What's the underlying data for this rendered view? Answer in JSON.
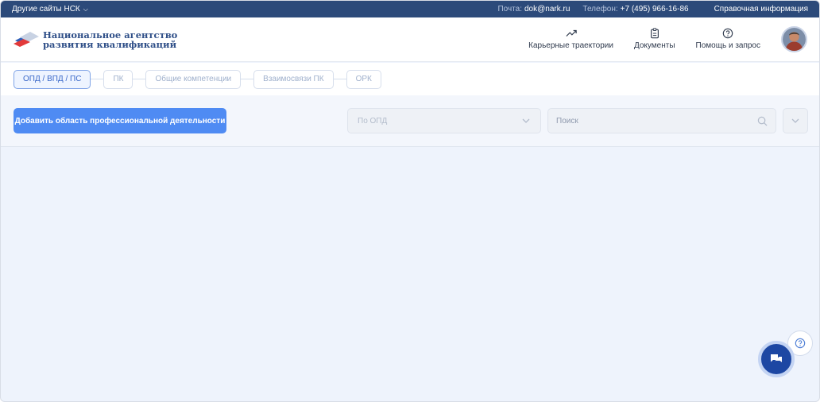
{
  "topbar": {
    "other_sites": "Другие сайты НСК",
    "mail_label": "Почта:",
    "mail_value": "dok@nark.ru",
    "phone_label": "Телефон:",
    "phone_value": "+7 (495) 966-16-86",
    "reference": "Справочная информация"
  },
  "header": {
    "logo_line1": "Национальное агентство",
    "logo_line2": "развития квалификаций",
    "nav": [
      {
        "label": "Карьерные траектории",
        "icon": "trending-up-icon"
      },
      {
        "label": "Документы",
        "icon": "clipboard-icon"
      },
      {
        "label": "Помощь и запрос",
        "icon": "help-circle-icon"
      }
    ]
  },
  "tabs": [
    {
      "label": "ОПД / ВПД / ПС",
      "active": true
    },
    {
      "label": "ПК",
      "active": false
    },
    {
      "label": "Общие компетенции",
      "active": false
    },
    {
      "label": "Взаимосвязи ПК",
      "active": false
    },
    {
      "label": "ОРК",
      "active": false
    }
  ],
  "toolbar": {
    "add_button": "Добавить область профессиональной деятельности",
    "select_value": "По ОПД",
    "search_placeholder": "Поиск"
  },
  "colors": {
    "topbar": "#2c4a7a",
    "accent": "#4f8bf3",
    "chat": "#1d47a3",
    "content_bg": "#eef3fc"
  }
}
